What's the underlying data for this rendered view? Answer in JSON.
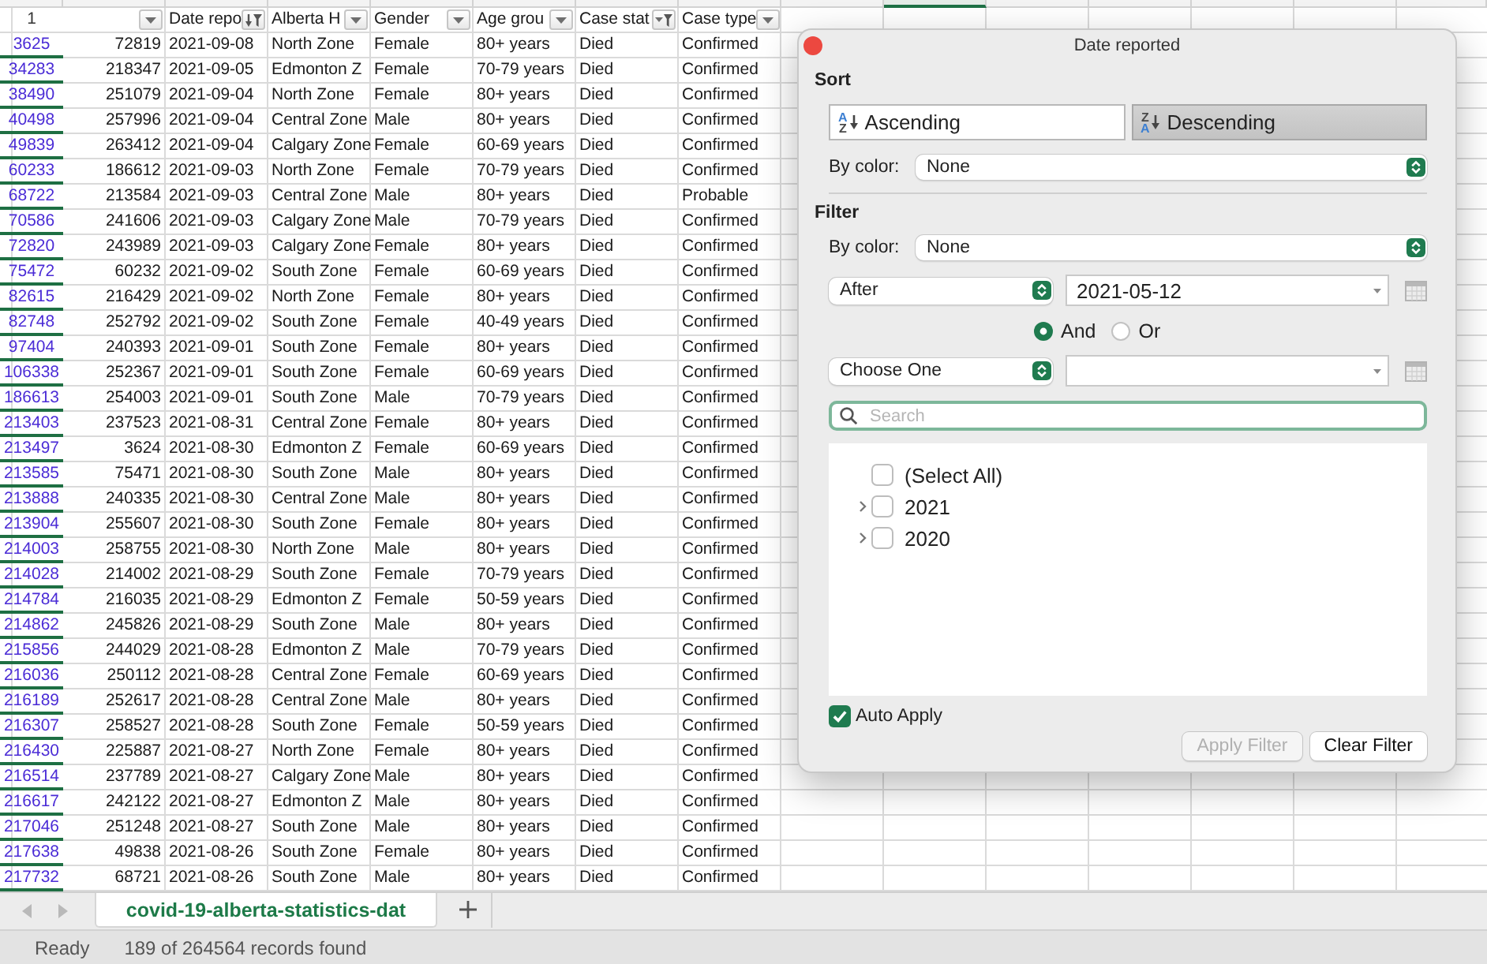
{
  "column_headers": [
    {
      "selected": false
    },
    {
      "selected": false
    },
    {
      "selected": false
    },
    {
      "selected": false
    },
    {
      "selected": false
    },
    {
      "selected": false
    },
    {
      "selected": false
    },
    {
      "selected": false
    },
    {
      "selected": false
    },
    {
      "selected": true
    },
    {
      "selected": false
    },
    {
      "selected": false
    },
    {
      "selected": false
    },
    {
      "selected": false
    },
    {
      "selected": false
    }
  ],
  "sheet": {
    "filtered": true,
    "header_row": {
      "row_number": "1",
      "columns": [
        {
          "kind": "dropdown"
        },
        {
          "label": "Date repo",
          "kind": "sorted"
        },
        {
          "label": "Alberta H",
          "kind": "dropdown"
        },
        {
          "label": "Gender",
          "kind": "dropdown"
        },
        {
          "label": "Age grou",
          "kind": "dropdown"
        },
        {
          "label": "Case stat",
          "kind": "filtered"
        },
        {
          "label": "Case type",
          "kind": "dropdown"
        }
      ]
    },
    "rows": [
      {
        "row_number": "3625",
        "cells": [
          "72819",
          "2021-09-08",
          "North Zone",
          "Female",
          "80+ years",
          "Died",
          "Confirmed"
        ]
      },
      {
        "row_number": "34283",
        "cells": [
          "218347",
          "2021-09-05",
          "Edmonton Z",
          "Female",
          "70-79 years",
          "Died",
          "Confirmed"
        ]
      },
      {
        "row_number": "38490",
        "cells": [
          "251079",
          "2021-09-04",
          "North Zone",
          "Female",
          "80+ years",
          "Died",
          "Confirmed"
        ]
      },
      {
        "row_number": "40498",
        "cells": [
          "257996",
          "2021-09-04",
          "Central Zone",
          "Male",
          "80+ years",
          "Died",
          "Confirmed"
        ]
      },
      {
        "row_number": "49839",
        "cells": [
          "263412",
          "2021-09-04",
          "Calgary Zone",
          "Female",
          "60-69 years",
          "Died",
          "Confirmed"
        ]
      },
      {
        "row_number": "60233",
        "cells": [
          "186612",
          "2021-09-03",
          "North Zone",
          "Female",
          "70-79 years",
          "Died",
          "Confirmed"
        ]
      },
      {
        "row_number": "68722",
        "cells": [
          "213584",
          "2021-09-03",
          "Central Zone",
          "Male",
          "80+ years",
          "Died",
          "Probable"
        ]
      },
      {
        "row_number": "70586",
        "cells": [
          "241606",
          "2021-09-03",
          "Calgary Zone",
          "Male",
          "70-79 years",
          "Died",
          "Confirmed"
        ]
      },
      {
        "row_number": "72820",
        "cells": [
          "243989",
          "2021-09-03",
          "Calgary Zone",
          "Female",
          "80+ years",
          "Died",
          "Confirmed"
        ]
      },
      {
        "row_number": "75472",
        "cells": [
          "60232",
          "2021-09-02",
          "South Zone",
          "Female",
          "60-69 years",
          "Died",
          "Confirmed"
        ]
      },
      {
        "row_number": "82615",
        "cells": [
          "216429",
          "2021-09-02",
          "North Zone",
          "Female",
          "80+ years",
          "Died",
          "Confirmed"
        ]
      },
      {
        "row_number": "82748",
        "cells": [
          "252792",
          "2021-09-02",
          "South Zone",
          "Female",
          "40-49 years",
          "Died",
          "Confirmed"
        ]
      },
      {
        "row_number": "97404",
        "cells": [
          "240393",
          "2021-09-01",
          "South Zone",
          "Female",
          "80+ years",
          "Died",
          "Confirmed"
        ]
      },
      {
        "row_number": "106338",
        "cells": [
          "252367",
          "2021-09-01",
          "South Zone",
          "Female",
          "60-69 years",
          "Died",
          "Confirmed"
        ]
      },
      {
        "row_number": "186613",
        "cells": [
          "254003",
          "2021-09-01",
          "South Zone",
          "Male",
          "70-79 years",
          "Died",
          "Confirmed"
        ]
      },
      {
        "row_number": "213403",
        "cells": [
          "237523",
          "2021-08-31",
          "Central Zone",
          "Female",
          "80+ years",
          "Died",
          "Confirmed"
        ]
      },
      {
        "row_number": "213497",
        "cells": [
          "3624",
          "2021-08-30",
          "Edmonton Z",
          "Female",
          "60-69 years",
          "Died",
          "Confirmed"
        ]
      },
      {
        "row_number": "213585",
        "cells": [
          "75471",
          "2021-08-30",
          "South Zone",
          "Male",
          "80+ years",
          "Died",
          "Confirmed"
        ]
      },
      {
        "row_number": "213888",
        "cells": [
          "240335",
          "2021-08-30",
          "Central Zone",
          "Male",
          "80+ years",
          "Died",
          "Confirmed"
        ]
      },
      {
        "row_number": "213904",
        "cells": [
          "255607",
          "2021-08-30",
          "South Zone",
          "Female",
          "80+ years",
          "Died",
          "Confirmed"
        ]
      },
      {
        "row_number": "214003",
        "cells": [
          "258755",
          "2021-08-30",
          "North Zone",
          "Male",
          "80+ years",
          "Died",
          "Confirmed"
        ]
      },
      {
        "row_number": "214028",
        "cells": [
          "214002",
          "2021-08-29",
          "South Zone",
          "Female",
          "70-79 years",
          "Died",
          "Confirmed"
        ]
      },
      {
        "row_number": "214784",
        "cells": [
          "216035",
          "2021-08-29",
          "Edmonton Z",
          "Female",
          "50-59 years",
          "Died",
          "Confirmed"
        ]
      },
      {
        "row_number": "214862",
        "cells": [
          "245826",
          "2021-08-29",
          "South Zone",
          "Male",
          "80+ years",
          "Died",
          "Confirmed"
        ]
      },
      {
        "row_number": "215856",
        "cells": [
          "244029",
          "2021-08-28",
          "Edmonton Z",
          "Male",
          "70-79 years",
          "Died",
          "Confirmed"
        ]
      },
      {
        "row_number": "216036",
        "cells": [
          "250112",
          "2021-08-28",
          "Central Zone",
          "Female",
          "60-69 years",
          "Died",
          "Confirmed"
        ]
      },
      {
        "row_number": "216189",
        "cells": [
          "252617",
          "2021-08-28",
          "Central Zone",
          "Male",
          "80+ years",
          "Died",
          "Confirmed"
        ]
      },
      {
        "row_number": "216307",
        "cells": [
          "258527",
          "2021-08-28",
          "South Zone",
          "Female",
          "50-59 years",
          "Died",
          "Confirmed"
        ]
      },
      {
        "row_number": "216430",
        "cells": [
          "225887",
          "2021-08-27",
          "North Zone",
          "Female",
          "80+ years",
          "Died",
          "Confirmed"
        ]
      },
      {
        "row_number": "216514",
        "cells": [
          "237789",
          "2021-08-27",
          "Calgary Zone",
          "Male",
          "80+ years",
          "Died",
          "Confirmed"
        ]
      },
      {
        "row_number": "216617",
        "cells": [
          "242122",
          "2021-08-27",
          "Edmonton Z",
          "Male",
          "80+ years",
          "Died",
          "Confirmed"
        ]
      },
      {
        "row_number": "217046",
        "cells": [
          "251248",
          "2021-08-27",
          "South Zone",
          "Male",
          "80+ years",
          "Died",
          "Confirmed"
        ]
      },
      {
        "row_number": "217638",
        "cells": [
          "49838",
          "2021-08-26",
          "South Zone",
          "Female",
          "80+ years",
          "Died",
          "Confirmed"
        ]
      },
      {
        "row_number": "217732",
        "cells": [
          "68721",
          "2021-08-26",
          "South Zone",
          "Male",
          "80+ years",
          "Died",
          "Confirmed"
        ]
      }
    ]
  },
  "filter_panel": {
    "title": "Date reported",
    "sort": {
      "heading": "Sort",
      "buttons": [
        {
          "kind": "ascending",
          "icon_top": "A",
          "icon_bottom": "Z",
          "label": "Ascending",
          "selected": false
        },
        {
          "kind": "descending",
          "icon_top": "Z",
          "icon_bottom": "A",
          "label": "Descending",
          "selected": true
        }
      ],
      "by_color": {
        "label": "By color:",
        "value": "None"
      }
    },
    "filter": {
      "heading": "Filter",
      "by_color": {
        "label": "By color:",
        "value": "None"
      },
      "conditions": [
        {
          "operator": "After",
          "value": "2021-05-12"
        },
        {
          "operator": "Choose One"
        }
      ],
      "join": [
        {
          "label": "And",
          "selected": true
        },
        {
          "label": "Or",
          "selected": false
        }
      ],
      "search": {
        "placeholder": "Search"
      },
      "values": [
        {
          "label": "(Select All)",
          "checked": false
        },
        {
          "label": "2021",
          "checked": false,
          "expanded": false
        },
        {
          "label": "2020",
          "checked": false,
          "expanded": false
        }
      ],
      "auto_apply": {
        "label": "Auto Apply",
        "checked": true
      },
      "buttons": [
        {
          "label": "Apply Filter",
          "disabled": true
        },
        {
          "label": "Clear Filter",
          "disabled": false
        }
      ]
    }
  },
  "sheet_tabs": [
    {
      "label": "covid-19-alberta-statistics-dat",
      "selected": true
    }
  ],
  "status_bar": {
    "mode": "Ready",
    "records": "189 of 264564 records found"
  }
}
